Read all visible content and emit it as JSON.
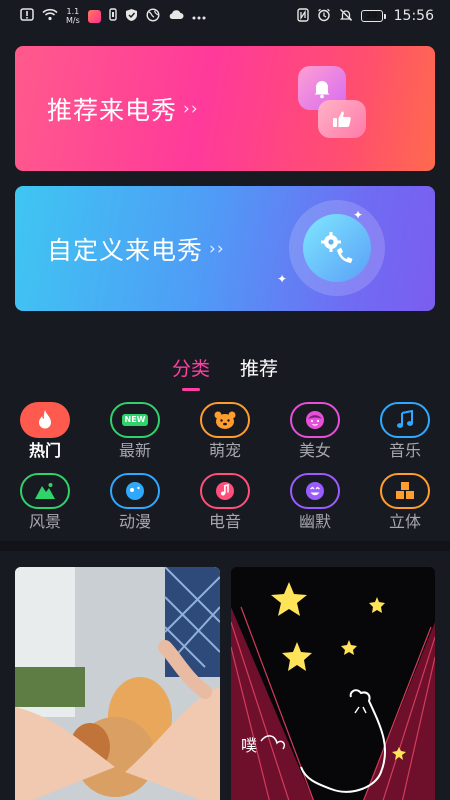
{
  "status_bar": {
    "net_speed_value": "1.1",
    "net_speed_unit": "M/s",
    "battery_level": "20",
    "time": "15:56"
  },
  "banners": [
    {
      "title": "推荐来电秀",
      "arrow": "››"
    },
    {
      "title": "自定义来电秀",
      "arrow": "››"
    }
  ],
  "tabs": [
    {
      "label": "分类",
      "active": true
    },
    {
      "label": "推荐",
      "active": false
    }
  ],
  "categories": [
    {
      "label": "热门",
      "icon": "flame-icon",
      "color": "#ff5a4e",
      "active": true
    },
    {
      "label": "最新",
      "icon": "new-badge-icon",
      "color": "#2fd26b",
      "badge": "NEW"
    },
    {
      "label": "萌宠",
      "icon": "pet-face-icon",
      "color": "#ff9d2e"
    },
    {
      "label": "美女",
      "icon": "girl-face-icon",
      "color": "#e84fd8"
    },
    {
      "label": "音乐",
      "icon": "music-note-icon",
      "color": "#2fa9ff"
    },
    {
      "label": "风景",
      "icon": "mountain-icon",
      "color": "#2fd26b"
    },
    {
      "label": "动漫",
      "icon": "anime-face-icon",
      "color": "#2fa9ff"
    },
    {
      "label": "电音",
      "icon": "music-disc-icon",
      "color": "#ff4f7a"
    },
    {
      "label": "幽默",
      "icon": "smile-icon",
      "color": "#9b5cff"
    },
    {
      "label": "立体",
      "icon": "cubes-icon",
      "color": "#ff9d2e"
    }
  ],
  "previews": [
    {
      "icon": "puppy-hands-photo"
    },
    {
      "icon": "stage-stars-cat-animation",
      "caption": "噗"
    }
  ]
}
